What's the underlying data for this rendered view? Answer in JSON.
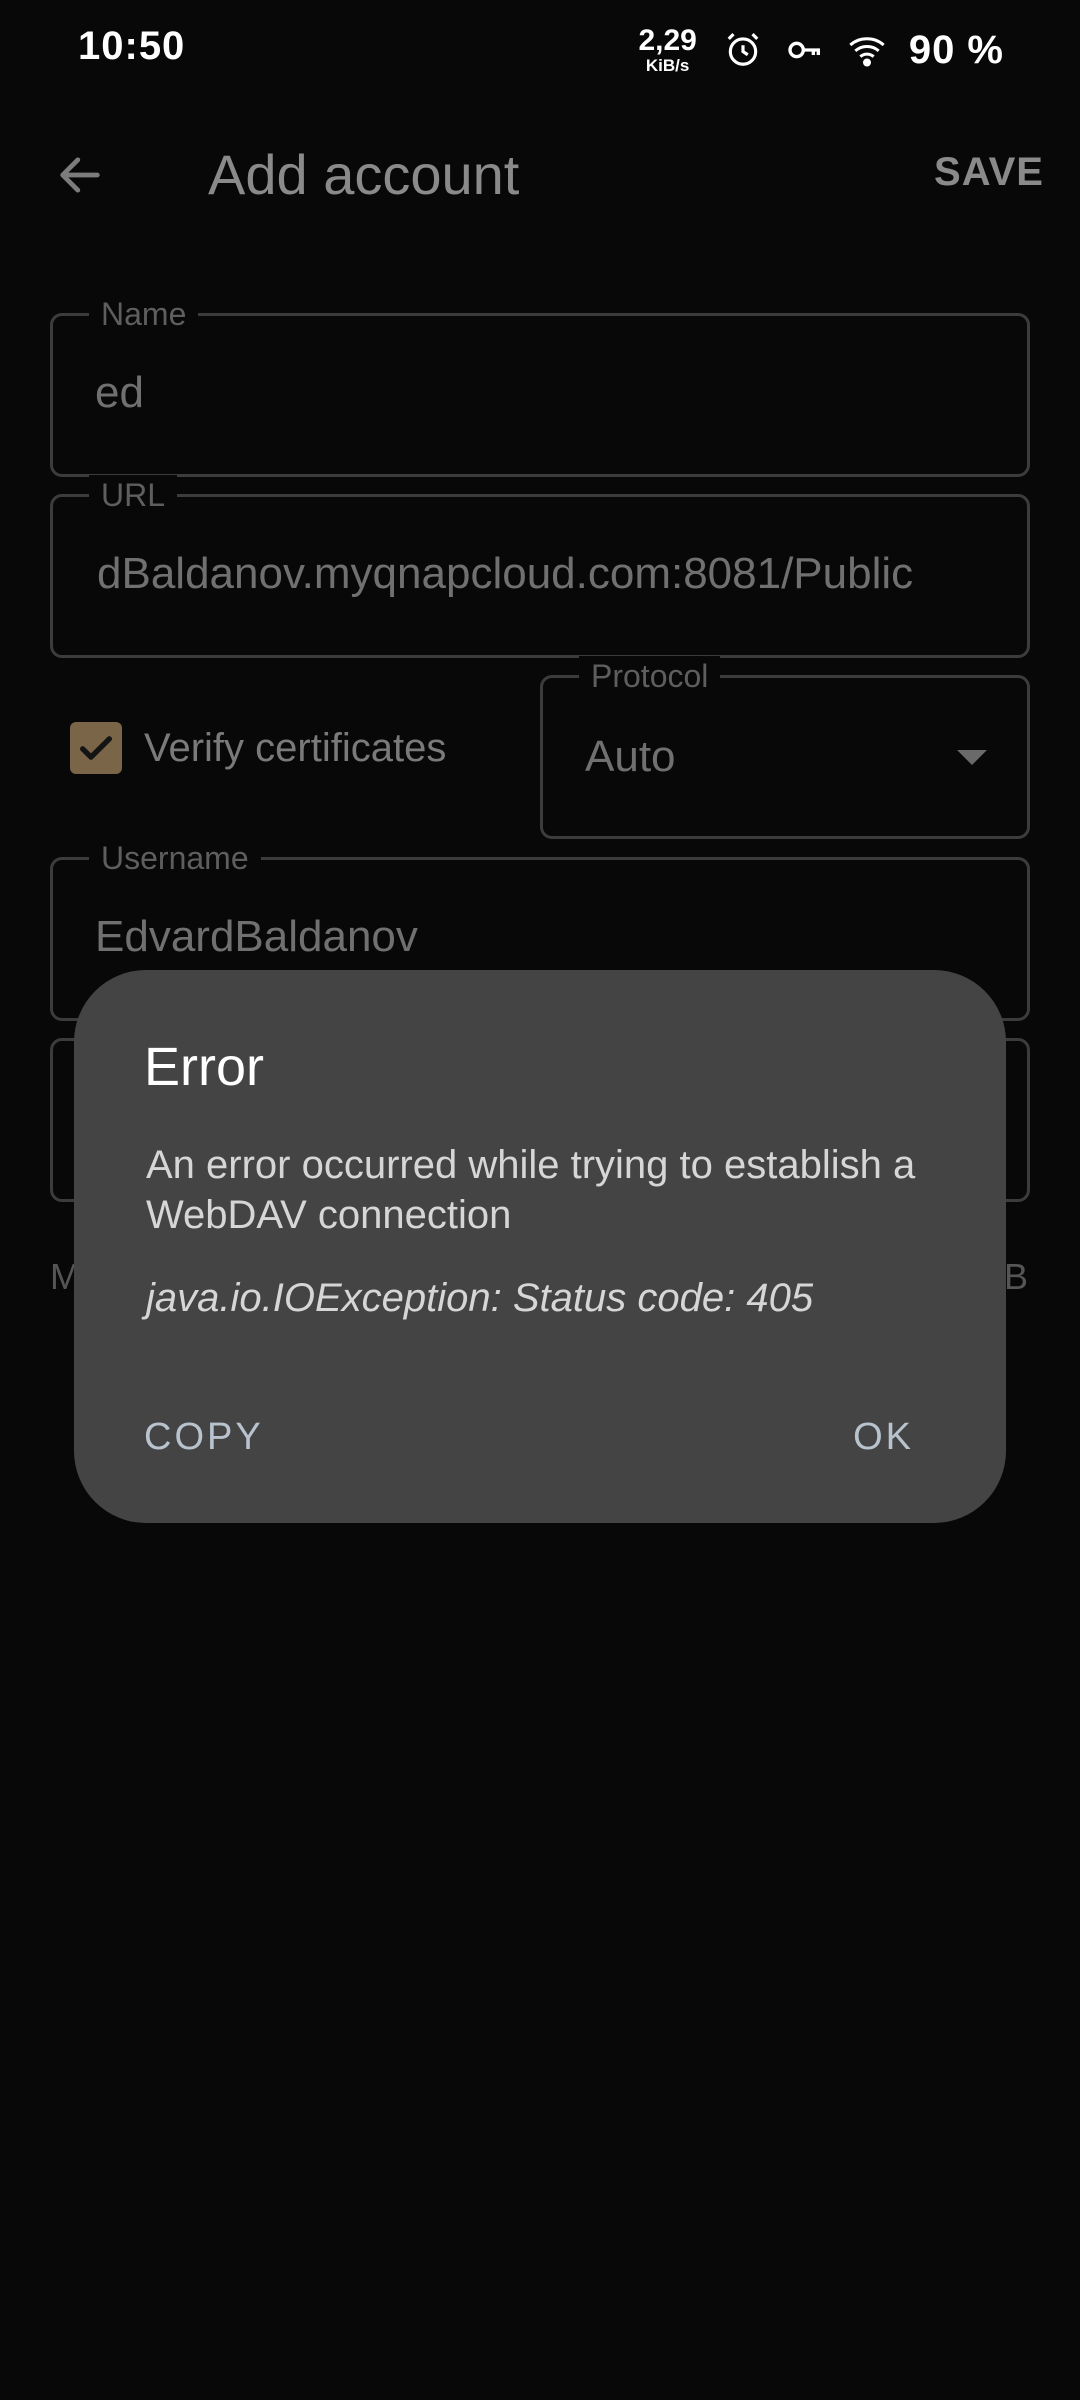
{
  "status_bar": {
    "time": "10:50",
    "net_speed_value": "2,29",
    "net_speed_unit": "KiB/s",
    "battery": "90 %",
    "icons": [
      "alarm-icon",
      "vpn-key-icon",
      "wifi-icon"
    ]
  },
  "app_bar": {
    "title": "Add account",
    "save_label": "SAVE",
    "back_icon": "arrow-back-icon"
  },
  "form": {
    "name": {
      "label": "Name",
      "value": "ed"
    },
    "url": {
      "label": "URL",
      "value": "dBaldanov.myqnapcloud.com:8081/Public"
    },
    "verify_certificates": {
      "label": "Verify certificates",
      "checked": true
    },
    "protocol": {
      "label": "Protocol",
      "value": "Auto"
    },
    "username": {
      "label": "Username",
      "value": "EdvardBaldanov"
    },
    "side_left": "M",
    "side_right": "B"
  },
  "dialog": {
    "title": "Error",
    "message": "An error occurred while trying to establish a WebDAV connection",
    "exception": "java.io.IOException: Status code: 405",
    "copy_label": "COPY",
    "ok_label": "OK"
  },
  "colors": {
    "background": "#080808",
    "dialog": "#444444",
    "checkbox": "#7a6548",
    "dialog_button": "#b9c3cd"
  }
}
